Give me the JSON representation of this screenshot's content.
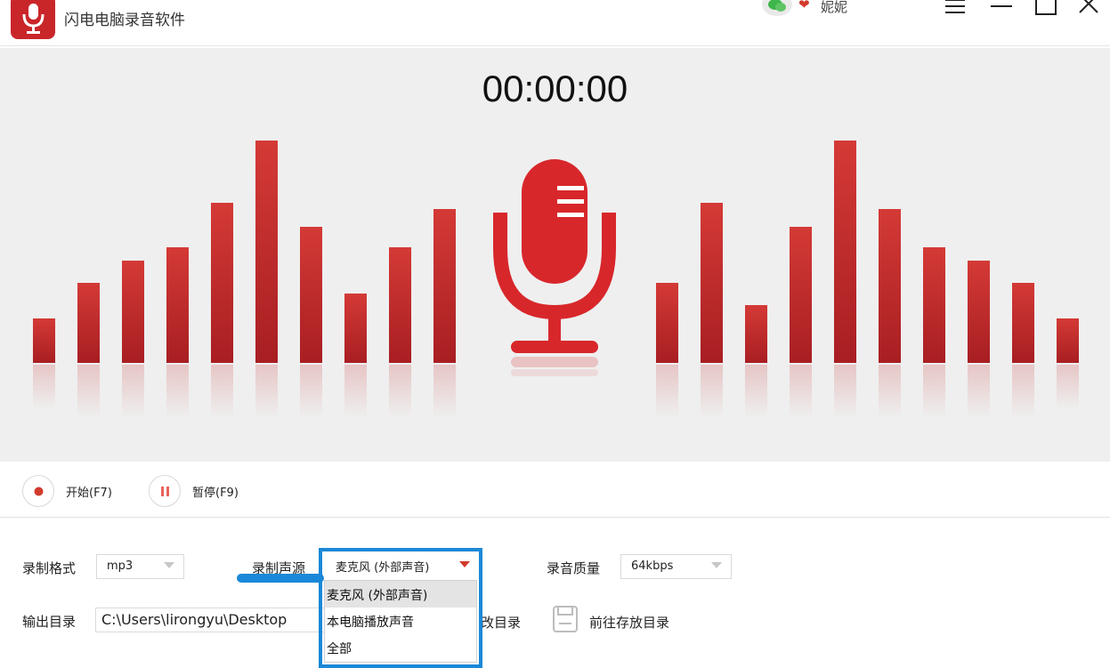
{
  "app": {
    "title": "闪电电脑录音软件",
    "user_name": "妮妮",
    "icons": [
      "microphone-logo-icon",
      "wechat-icon",
      "vip-heart-icon",
      "menu-icon",
      "minimize-icon",
      "maximize-icon",
      "close-icon"
    ]
  },
  "visualizer": {
    "timer": "00:00:00",
    "accent_color": "#c9262a",
    "left_bar_levels": [
      0.2,
      0.36,
      0.46,
      0.52,
      0.72,
      1.0,
      0.61,
      0.31,
      0.52,
      0.69
    ],
    "right_bar_levels": [
      0.36,
      0.72,
      0.26,
      0.61,
      1.0,
      0.69,
      0.52,
      0.46,
      0.36,
      0.2
    ]
  },
  "toolbar": {
    "start_label": "开始(F7)",
    "pause_label": "暂停(F9)"
  },
  "settings": {
    "format_label": "录制格式",
    "format_value": "mp3",
    "source_label": "录制声源",
    "source_value": "麦克风 (外部声音)",
    "source_options": [
      "麦克风 (外部声音)",
      "本电脑播放声音",
      "全部"
    ],
    "quality_label": "录音质量",
    "quality_value": "64kbps",
    "output_label": "输出目录",
    "output_path": "C:\\Users\\lirongyu\\Desktop",
    "open_dir_partial": "改目录",
    "goto_dir_label": "前往存放目录",
    "highlight_color": "#1a88d8"
  }
}
